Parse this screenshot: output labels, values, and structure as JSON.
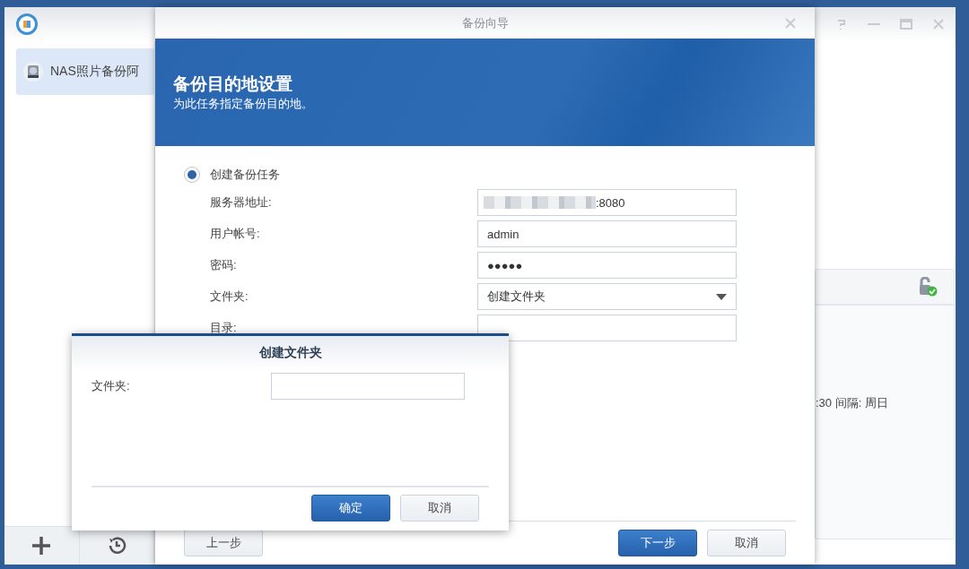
{
  "app": {
    "sidebar_items": [
      {
        "label": "NAS照片备份阿",
        "selected": true
      }
    ],
    "task_card": {
      "schedule": ":30 间隔: 周日"
    }
  },
  "wizard": {
    "title": "备份向导",
    "banner_title": "备份目的地设置",
    "banner_subtitle": "为此任务指定备份目的地。",
    "option": {
      "label": "创建备份任务",
      "selected": true
    },
    "fields": [
      {
        "label": "服务器地址:",
        "value": ":8080",
        "kind": "text",
        "redacted": true
      },
      {
        "label": "用户帐号:",
        "value": "admin",
        "kind": "text"
      },
      {
        "label": "密码:",
        "value": "●●●●●",
        "kind": "text"
      },
      {
        "label": "文件夹:",
        "value": "创建文件夹",
        "kind": "select"
      },
      {
        "label": "目录:",
        "kind": "text"
      }
    ],
    "back_button": "上一步",
    "next_button": "下一步",
    "cancel_button": "取消"
  },
  "dialog": {
    "title": "创建文件夹",
    "field_label": "文件夹:",
    "ok_button": "确定",
    "cancel_button": "取消"
  }
}
